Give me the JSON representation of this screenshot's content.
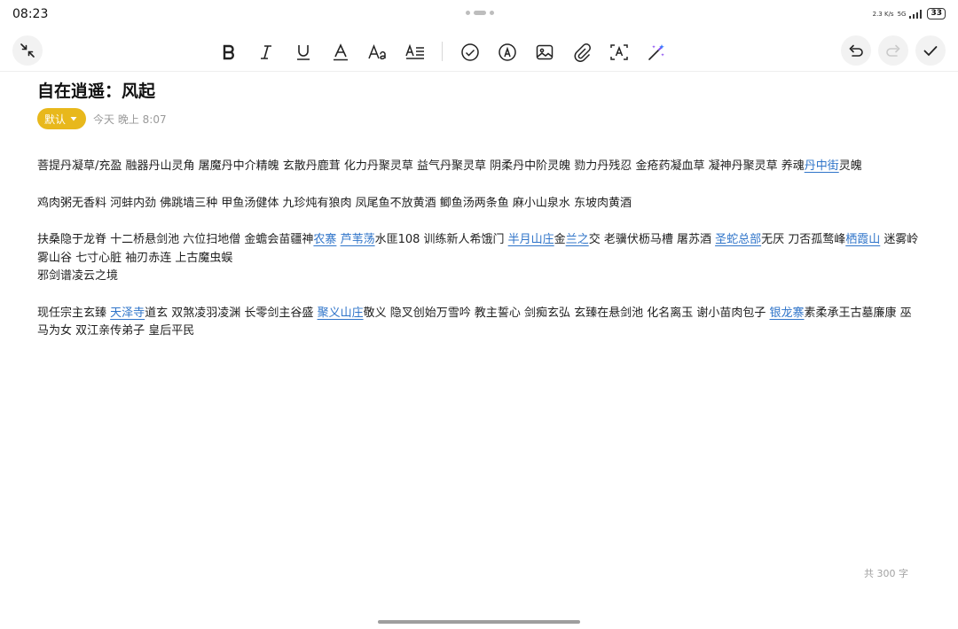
{
  "status_bar": {
    "time": "08:23",
    "network": "2.3 K/s",
    "signal": "5G",
    "battery": "33"
  },
  "toolbar": {
    "icons": [
      "collapse-icon",
      "bold-icon",
      "italic-icon",
      "underline-icon",
      "text-color-icon",
      "font-size-icon",
      "paragraph-format-icon",
      "checklist-icon",
      "pen-icon",
      "image-icon",
      "attachment-icon",
      "scan-text-icon",
      "ai-magic-icon",
      "undo-icon",
      "redo-icon",
      "done-icon"
    ]
  },
  "note": {
    "title": "自在逍遥：风起",
    "category": "默认",
    "date": "今天 晚上 8:07",
    "word_count": "共 300 字"
  },
  "paragraphs": [
    [
      {
        "t": "菩提丹凝草/充盈 融器丹山灵角 屠魔丹中介精魄 玄散丹鹿茸 化力丹聚灵草 益气丹聚灵草 阴柔丹中阶灵魄 勠力丹残忍 金疮药凝血草 凝神丹聚灵草 养魂"
      },
      {
        "t": "丹中街",
        "link": true
      },
      {
        "t": "灵魄"
      }
    ],
    [
      {
        "t": "鸡肉粥无香料 河蚌内劲 佛跳墙三种 甲鱼汤健体 九珍炖有狼肉 凤尾鱼不放黄酒 鲫鱼汤两条鱼 麻小山泉水 东坡肉黄酒"
      }
    ],
    [
      {
        "t": "扶桑隐于龙脊 十二桥悬剑池 六位扫地僧 金蟾会苗疆神"
      },
      {
        "t": "农寨",
        "link": true
      },
      {
        "t": " "
      },
      {
        "t": "芦苇荡",
        "link": true
      },
      {
        "t": "水匪108 训练新人希饿门 "
      },
      {
        "t": "半月山庄",
        "link": true
      },
      {
        "t": "金"
      },
      {
        "t": "兰之",
        "link": true
      },
      {
        "t": "交 老骥伏枥马槽 屠苏酒 "
      },
      {
        "t": "圣蛇总部",
        "link": true
      },
      {
        "t": "无厌 刀否孤鹜峰"
      },
      {
        "t": "栖霞山",
        "link": true
      },
      {
        "t": " 迷雾岭雾山谷 七寸心脏 袖刃赤连 上古魔虫蜈"
      },
      {
        "t": "\n邪剑谱凌云之境"
      }
    ],
    [
      {
        "t": "现任宗主玄臻 "
      },
      {
        "t": "天泽寺",
        "link": true
      },
      {
        "t": "道玄 双煞凌羽凌渊 长零剑主谷盛 "
      },
      {
        "t": "聚义山庄",
        "link": true
      },
      {
        "t": "敬义 隐叉创始万雪吟 教主誓心 剑痴玄弘 玄臻在悬剑池 化名离玉 谢小苗肉包子 "
      },
      {
        "t": "银龙寨",
        "link": true
      },
      {
        "t": "素柔承王古墓廉康 巫马为女 双江亲传弟子 皇后平民"
      }
    ]
  ]
}
